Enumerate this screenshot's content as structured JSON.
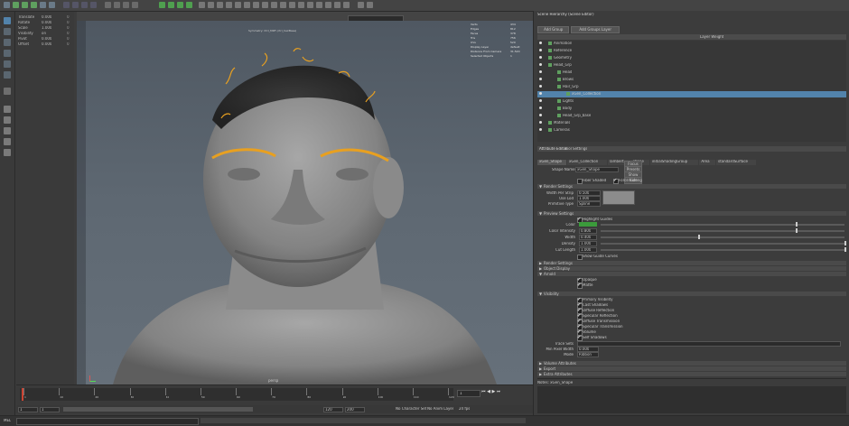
{
  "viewport": {
    "menu": [
      "View",
      "Shading",
      "Lighting",
      "Show",
      "Renderer",
      "Panels"
    ],
    "camera_name": "persp",
    "hud_title": "Symmetry: Ctrl_MRF (ctrl_hairBase)"
  },
  "channel_box": {
    "rows": [
      {
        "name": "Translate",
        "value": "0.000",
        "extra": "0"
      },
      {
        "name": "Rotate",
        "value": "0.000",
        "extra": "0"
      },
      {
        "name": "Scale",
        "value": "1.000",
        "extra": "0"
      },
      {
        "name": "Visibility",
        "value": "on",
        "extra": "0"
      },
      {
        "name": "Pivot",
        "value": "0.000",
        "extra": "0"
      },
      {
        "name": "Offset",
        "value": "0.000",
        "extra": "0"
      }
    ]
  },
  "hud_stats": [
    {
      "label": "Verts",
      "value": "434"
    },
    {
      "label": "Edges",
      "value": "812"
    },
    {
      "label": "Faces",
      "value": "378"
    },
    {
      "label": "Tris",
      "value": "756"
    },
    {
      "label": "UVs",
      "value": "520"
    },
    {
      "label": "Display Layer",
      "value": "default"
    },
    {
      "label": "Distance From Camera",
      "value": "31.520"
    },
    {
      "label": "Selected Objects",
      "value": "1"
    }
  ],
  "outliner": {
    "title": "Scene Hierarchy (Scene Editor)",
    "menu": [
      "File",
      "Create",
      "Search",
      "Decorations",
      "Help"
    ],
    "buttons": [
      "Add Group",
      "Add Groups Layer"
    ],
    "column_header": "Layer Weight",
    "items": [
      {
        "label": "Animation",
        "indent": 0,
        "selected": false
      },
      {
        "label": "Reference",
        "indent": 0,
        "selected": false
      },
      {
        "label": "Geometry",
        "indent": 0,
        "selected": false
      },
      {
        "label": "Head_Grp",
        "indent": 0,
        "selected": false
      },
      {
        "label": "Head",
        "indent": 1,
        "selected": false
      },
      {
        "label": "Brows",
        "indent": 1,
        "selected": false
      },
      {
        "label": "Hair_Grp",
        "indent": 1,
        "selected": false
      },
      {
        "label": "xGen_Collection",
        "indent": 2,
        "selected": true
      },
      {
        "label": "Lights",
        "indent": 1,
        "selected": false
      },
      {
        "label": "Body",
        "indent": 1,
        "selected": false
      },
      {
        "label": "Head_Grp_base",
        "indent": 1,
        "selected": false
      },
      {
        "label": "Materials",
        "indent": 0,
        "selected": false
      },
      {
        "label": "Cameras",
        "indent": 0,
        "selected": false
      }
    ]
  },
  "attr_editor": {
    "title": "Attribute Editor",
    "tab2": "Tool Settings",
    "menu": [
      "List",
      "Selected",
      "Focus",
      "Attributes",
      "Show",
      "Help"
    ],
    "node_tabs": [
      "xGen_Shape",
      "xGen_Collection",
      "lambert",
      "shape",
      "initialShadingGroup",
      "Area",
      "standardSurface"
    ],
    "shape_label": "xGen_Shape",
    "shape_field_label": "Shape Name:",
    "shape_field_value": "xGen_Shape",
    "side_btns": [
      "Focus",
      "Presets",
      "Show",
      "Hide"
    ],
    "check_row": [
      "Fiber Shaded",
      "Force Culling"
    ],
    "sections": {
      "mesh": "Render Settings",
      "display": "Preview Settings",
      "render": "Render Settings",
      "object": "Object Display",
      "arnold": "Arnold",
      "visibility": "Visibility",
      "shadow": "Shadows",
      "volume": "Volume Attributes",
      "export": "Export",
      "extra": "Extra Attributes"
    },
    "mesh_fields": [
      {
        "label": "Width Per Strip",
        "value": "0.500"
      },
      {
        "label": "Use Lod",
        "value": "1.000"
      },
      {
        "label": "Primitive Type",
        "value": "Spline"
      }
    ],
    "display_rows": [
      {
        "label": "Color",
        "value": "0.800"
      },
      {
        "label": "Color Intensity",
        "value": "0.800"
      },
      {
        "label": "Width",
        "value": "0.400"
      },
      {
        "label": "Density",
        "value": "1.000"
      },
      {
        "label": "Cut Length",
        "value": "1.000"
      }
    ],
    "display_checks": [
      "Highlight Guides",
      "Show Guide Curves"
    ],
    "visibility_checks": [
      "Primary Visibility",
      "Cast Shadows",
      "Diffuse Reflection",
      "Specular Reflection",
      "Diffuse Transmission",
      "Specular Transmission",
      "Volume",
      "Self Shadows"
    ],
    "extra_fields": [
      {
        "label": "Trace Sets",
        "value": ""
      },
      {
        "label": "Min Pixel Width",
        "value": "0.000"
      },
      {
        "label": "Mode",
        "value": "Ribbon"
      }
    ],
    "arnold_checks": [
      "Opaque",
      "Matte"
    ],
    "bottom_label": "Notes: xGen_Shape"
  },
  "timeline": {
    "ticks": [
      "1",
      "10",
      "20",
      "30",
      "40",
      "50",
      "60",
      "70",
      "80",
      "90",
      "100",
      "110",
      "120"
    ],
    "current_frame": "1",
    "start": "1",
    "end": "120",
    "range_end": "200",
    "range_start_field": "1",
    "range_end_field": "120",
    "fps": "24 fps",
    "no_char": "No Character Set",
    "no_anim": "No Anim Layer"
  },
  "cmdline": {
    "mel": "MEL"
  },
  "colors": {
    "accent": "#3a7bbf",
    "hair": "#e8a020",
    "selection": "#5283ab"
  }
}
